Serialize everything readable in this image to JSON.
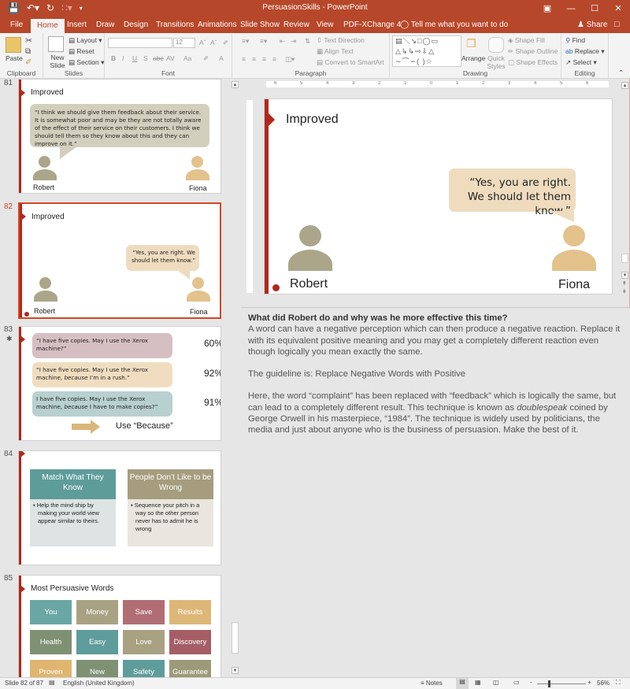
{
  "window": {
    "title": "PersuasionSkills - PowerPoint",
    "controls": [
      "ribbon-display-options",
      "minimize",
      "maximize",
      "close"
    ]
  },
  "tabs": [
    {
      "label": "File",
      "active": false
    },
    {
      "label": "Home",
      "active": true
    },
    {
      "label": "Insert",
      "active": false
    },
    {
      "label": "Draw",
      "active": false
    },
    {
      "label": "Design",
      "active": false
    },
    {
      "label": "Transitions",
      "active": false
    },
    {
      "label": "Animations",
      "active": false
    },
    {
      "label": "Slide Show",
      "active": false
    },
    {
      "label": "Review",
      "active": false
    },
    {
      "label": "View",
      "active": false
    },
    {
      "label": "PDF-XChange 4",
      "active": false
    }
  ],
  "tell_me": "Tell me what you want to do",
  "share": "Share",
  "ribbon": {
    "clipboard": {
      "label": "Clipboard",
      "paste": "Paste"
    },
    "slides": {
      "label": "Slides",
      "new_slide": "New Slide",
      "layout": "Layout",
      "reset": "Reset",
      "section": "Section"
    },
    "font": {
      "label": "Font",
      "font_name": "",
      "font_size": "12",
      "bold": "B",
      "italic": "I",
      "underline": "U",
      "shadow": "S",
      "strike": "abc",
      "spacing": "AV",
      "case": "Aa"
    },
    "paragraph": {
      "label": "Paragraph",
      "text_direction": "Text Direction",
      "align_text": "Align Text",
      "convert_smartart": "Convert to SmartArt"
    },
    "drawing": {
      "label": "Drawing",
      "arrange": "Arrange",
      "quick_styles": "Quick Styles",
      "shape_fill": "Shape Fill",
      "shape_outline": "Shape Outline",
      "shape_effects": "Shape Effects"
    },
    "editing": {
      "label": "Editing",
      "find": "Find",
      "replace": "Replace",
      "select": "Select"
    }
  },
  "thumbnails": [
    {
      "number": "81",
      "title": "Improved",
      "bubble": "“I think we should give them feedback about their service. It is somewhat poor and may be they are not totally aware of the effect of their service on their customers. I think we should tell them so they know about this and they can improve on it.”",
      "left_name": "Robert",
      "right_name": "Fiona"
    },
    {
      "number": "82",
      "selected": true,
      "title": "Improved",
      "bubble": "“Yes, you are right. We should let them know.”",
      "left_name": "Robert",
      "right_name": "Fiona"
    },
    {
      "number": "83",
      "has_animation": true,
      "rows": [
        {
          "text_pre": "“I have five copies. May I use the Xerox machine?”",
          "italic": "",
          "text_post": "",
          "percent": "60%",
          "color": "#d6bfc2"
        },
        {
          "text_pre": "“I have five copies. May I use the Xerox machine, ",
          "italic": "because",
          "text_post": " I’m in a rush.”",
          "percent": "92%",
          "color": "#f0ddc0"
        },
        {
          "text_pre": "I have five copies. May I use the Xerox machine, ",
          "italic": "because",
          "text_post": " I have to make copies?”",
          "percent": "91%",
          "color": "#b8d0cf"
        }
      ],
      "footer": "Use “Because”"
    },
    {
      "number": "84",
      "cards": [
        {
          "title": "Match What They Know",
          "bullet": "Help the mind ship by making your world view appear similar to theirs.",
          "color": "#5e9c9a"
        },
        {
          "title": "People Don’t Like to be Wrong",
          "bullet": "Sequence your pitch in a way so the other person never has to admit he is wrong",
          "color": "#a59d7e"
        }
      ]
    },
    {
      "number": "85",
      "title": "Most Persuasive Words",
      "words": [
        {
          "label": "You",
          "color": "#6aa6a3"
        },
        {
          "label": "Money",
          "color": "#a8a283"
        },
        {
          "label": "Save",
          "color": "#b06d74"
        },
        {
          "label": "Results",
          "color": "#dcb777"
        },
        {
          "label": "Health",
          "color": "#7f9173"
        },
        {
          "label": "Easy",
          "color": "#5f9c9c"
        },
        {
          "label": "Love",
          "color": "#a8a283"
        },
        {
          "label": "Discovery",
          "color": "#a55e65"
        },
        {
          "label": "Proven",
          "color": "#dfb56f"
        },
        {
          "label": "New",
          "color": "#7f9173"
        },
        {
          "label": "Safety",
          "color": "#5f9c9c"
        },
        {
          "label": "Guarantee",
          "color": "#9c9a78"
        }
      ]
    }
  ],
  "main_slide": {
    "title": "Improved",
    "bubble": "“Yes, you are right. We should let them know.”",
    "left_name": "Robert",
    "right_name": "Fiona",
    "ruler_labels": [
      "6",
      "5",
      "4",
      "3",
      "2",
      "1",
      "0",
      "1",
      "2",
      "3",
      "4",
      "5",
      "6"
    ]
  },
  "notes": {
    "heading": "What did Robert do and why was he more effective this time?",
    "p1": "A word can have a negative perception which can then produce a negative reaction. Replace it with its equivalent positive meaning and you may get a completely different reaction even though logically you mean exactly the same.",
    "p2": "The guideline is: Replace Negative Words with Positive",
    "p3_pre": "Here, the word “complaint” has been replaced with “feedback” which is logically the same, but can lead to a completely different result. This technique is known as ",
    "p3_italic": "doublespeak",
    "p3_post": " coined by George Orwell in his masterpiece, “1984”. The technique is widely used by politicians, the media and just about anyone who is the business of persuasion. Make the best of it."
  },
  "status": {
    "slide_info": "Slide 82 of 87",
    "language": "English (United Kingdom)",
    "notes_label": "Notes",
    "zoom": "56%",
    "zoom_minus": "-",
    "zoom_plus": "+"
  },
  "colors": {
    "accent": "#b7472a",
    "selection": "#d24726",
    "slide_bar": "#b0281c",
    "robert": "#aba68a",
    "fiona": "#e3c28c",
    "bubble_fiona": "#efdcbf",
    "bubble_robert": "#d3cfbd"
  }
}
